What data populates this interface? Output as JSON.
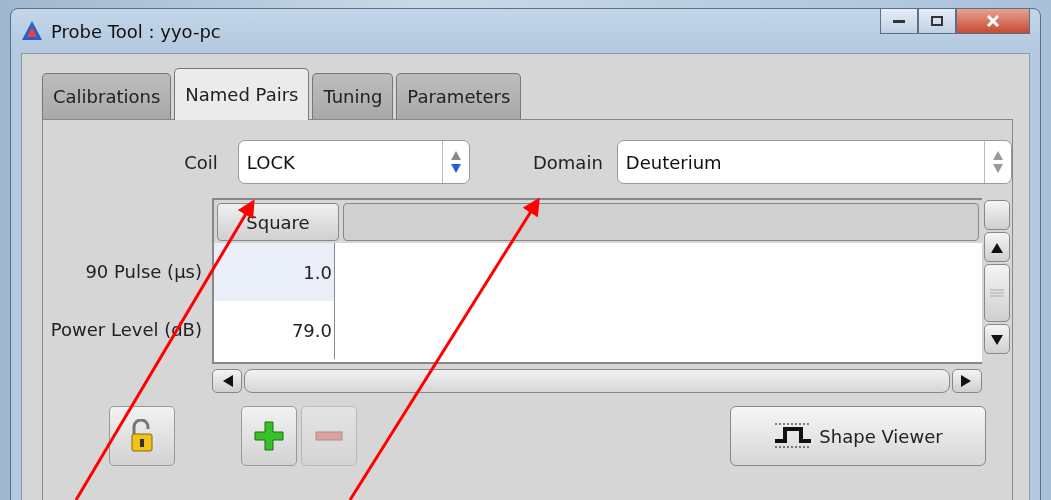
{
  "window": {
    "title": "Probe Tool : yyo-pc"
  },
  "tabs": [
    {
      "label": "Calibrations",
      "selected": false
    },
    {
      "label": "Named Pairs",
      "selected": true
    },
    {
      "label": "Tuning",
      "selected": false
    },
    {
      "label": "Parameters",
      "selected": false
    }
  ],
  "coil": {
    "label": "Coil",
    "value": "LOCK"
  },
  "domain": {
    "label": "Domain",
    "value": "Deuterium"
  },
  "table": {
    "columns": [
      "Square"
    ],
    "rows": [
      {
        "label": "90 Pulse (µs)",
        "value": "1.0",
        "selected": true
      },
      {
        "label": "Power Level (dB)",
        "value": "79.0",
        "selected": false
      }
    ]
  },
  "buttons": {
    "lock": {
      "disabled": false
    },
    "add": {
      "disabled": false
    },
    "remove": {
      "disabled": true
    },
    "shape_viewer": {
      "label": "Shape Viewer"
    }
  }
}
